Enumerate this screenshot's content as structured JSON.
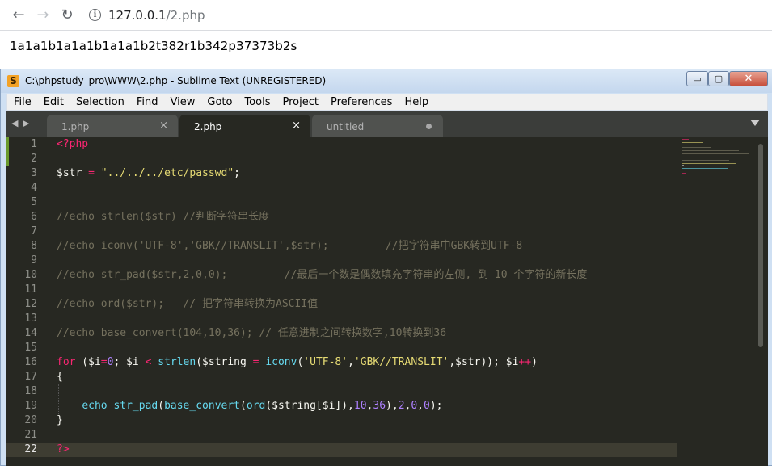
{
  "browser": {
    "url_host": "127.0.0.1",
    "url_path": "/2.php",
    "back_icon": "arrow-left-icon",
    "forward_icon": "arrow-right-icon",
    "reload_icon": "reload-icon",
    "info_icon": "info-icon"
  },
  "page": {
    "output": "1a1a1b1a1a1b1a1a1b2t382r1b342p37373b2s"
  },
  "window": {
    "title": "C:\\phpstudy_pro\\WWW\\2.php - Sublime Text (UNREGISTERED)",
    "minimize": "▭",
    "maximize": "▢",
    "close": "✕"
  },
  "menu": [
    "File",
    "Edit",
    "Selection",
    "Find",
    "View",
    "Goto",
    "Tools",
    "Project",
    "Preferences",
    "Help"
  ],
  "tabs": [
    {
      "label": "1.php",
      "state": "inactive",
      "close": "×"
    },
    {
      "label": "2.php",
      "state": "active",
      "close": "×"
    },
    {
      "label": "untitled",
      "state": "dirty"
    }
  ],
  "editor": {
    "current_line": 22,
    "line_numbers": [
      "1",
      "2",
      "3",
      "4",
      "5",
      "6",
      "7",
      "8",
      "9",
      "10",
      "11",
      "12",
      "13",
      "14",
      "15",
      "16",
      "17",
      "18",
      "19",
      "20",
      "21",
      "22"
    ],
    "colors": {
      "background": "#272822",
      "keyword": "#f92672",
      "string": "#e6db74",
      "function": "#66d9ef",
      "number": "#ae81ff",
      "comment": "#75715e",
      "text": "#f8f8f2"
    },
    "code": {
      "l1_open": "<?php",
      "l3_var": "$str",
      "l3_eq": " = ",
      "l3_str": "\"../../../etc/passwd\"",
      "l3_end": ";",
      "l6_comment": "//echo strlen($str) //判断字符串长度",
      "l8_comment": "//echo iconv('UTF-8','GBK//TRANSLIT',$str);         //把字符串中GBK转到UTF-8",
      "l10_comment": "//echo str_pad($str,2,0,0);         //最后一个数是偶数填充字符串的左侧, 到 10 个字符的新长度",
      "l12_comment": "//echo ord($str);   // 把字符串转换为ASCII值",
      "l14_comment": "//echo base_convert(104,10,36); // 任意进制之间转换数字,10转换到36",
      "l16_for": "for",
      "l16_open": " ($i",
      "l16_eq1": "=",
      "l16_zero": "0",
      "l16_mid": "; $i ",
      "l16_lt": "<",
      "l16_sp": " ",
      "l16_strlen": "strlen",
      "l16_str_open": "($string ",
      "l16_eq2": "=",
      "l16_sp2": " ",
      "l16_iconv": "iconv",
      "l16_p1": "(",
      "l16_utf8": "'UTF-8'",
      "l16_comma": ",",
      "l16_gbk": "'GBK//TRANSLIT'",
      "l16_rest": ",$str)); $i",
      "l16_inc": "++",
      "l16_close": ")",
      "l17": "{",
      "l19_indent": "    ",
      "l19_echo": "echo",
      "l19_sp": " ",
      "l19_strpad": "str_pad",
      "l19_p1": "(",
      "l19_baseconv": "base_convert",
      "l19_p2": "(",
      "l19_ord": "ord",
      "l19_arg": "($string[$i]),",
      "l19_n10": "10",
      "l19_c1": ",",
      "l19_n36": "36",
      "l19_mid": "),",
      "l19_n2": "2",
      "l19_c2": ",",
      "l19_n0a": "0",
      "l19_c3": ",",
      "l19_n0b": "0",
      "l19_end": ");",
      "l20": "}",
      "l22_close": "?>"
    }
  }
}
